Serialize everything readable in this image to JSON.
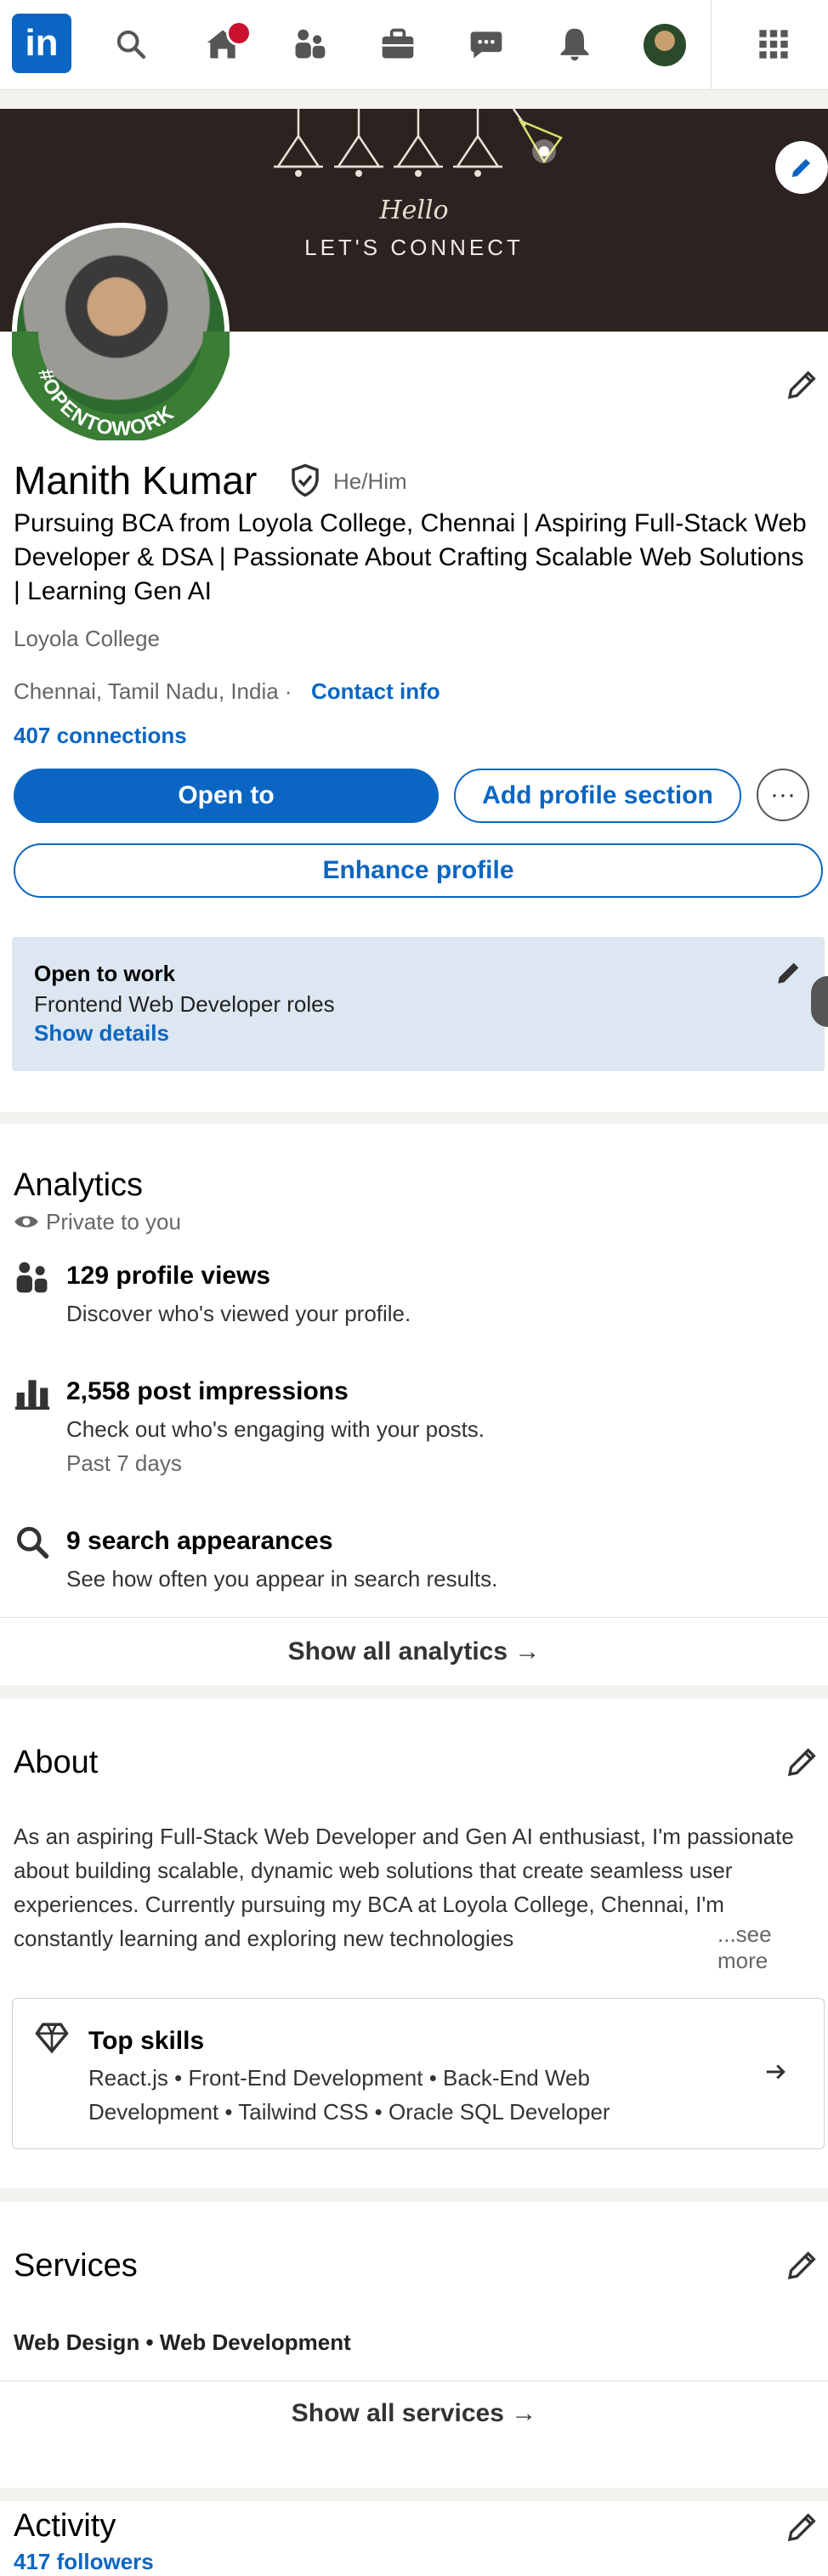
{
  "nav": {
    "logo": "in",
    "icons": [
      "search-icon",
      "home-icon",
      "network-icon",
      "jobs-icon",
      "messaging-icon",
      "notifications-icon",
      "me-avatar",
      "apps-grid-icon"
    ]
  },
  "banner": {
    "hello": "Hello",
    "connect": "LET'S CONNECT"
  },
  "avatar": {
    "badge_text": "#OPENTOWORK"
  },
  "profile": {
    "name": "Manith Kumar",
    "pronouns": "He/Him",
    "headline": "Pursuing BCA from Loyola College, Chennai | Aspiring Full-Stack Web Developer & DSA | Passionate About Crafting Scalable Web Solutions | Learning Gen AI",
    "education": "Loyola College",
    "location": "Chennai, Tamil Nadu, India · ",
    "contact_info": "Contact info",
    "connections": "407 connections"
  },
  "actions": {
    "open_to": "Open to",
    "add_section": "Add profile section",
    "more": "···",
    "enhance": "Enhance profile"
  },
  "open_to_work": {
    "title": "Open to work",
    "roles": "Frontend Web Developer roles",
    "show_details": "Show details"
  },
  "analytics": {
    "title": "Analytics",
    "privacy": "Private to you",
    "items": [
      {
        "title": "129 profile views",
        "desc": "Discover who's viewed your profile.",
        "note": ""
      },
      {
        "title": "2,558 post impressions",
        "desc": "Check out who's engaging with your posts.",
        "note": "Past 7 days"
      },
      {
        "title": "9 search appearances",
        "desc": "See how often you appear in search results.",
        "note": ""
      }
    ],
    "show_all": "Show all analytics →"
  },
  "about": {
    "title": "About",
    "text": "As an aspiring Full-Stack Web Developer and Gen AI enthusiast, I'm passionate about building scalable, dynamic web solutions that create seamless user experiences. Currently pursuing my BCA at Loyola College, Chennai, I'm constantly learning and exploring new technologies",
    "see_more": "...see more",
    "top_skills_label": "Top skills",
    "top_skills": "React.js • Front-End Development • Back-End Web Development • Tailwind CSS • Oracle SQL Developer"
  },
  "services": {
    "title": "Services",
    "list": "Web Design • Web Development",
    "show_all": "Show all services →"
  },
  "activity": {
    "title": "Activity",
    "followers": "417 followers"
  },
  "colors": {
    "brand": "#0a66c2",
    "banner": "#2c2220",
    "open_to_work_bg": "#dde7f1",
    "notification": "#cb112d"
  }
}
